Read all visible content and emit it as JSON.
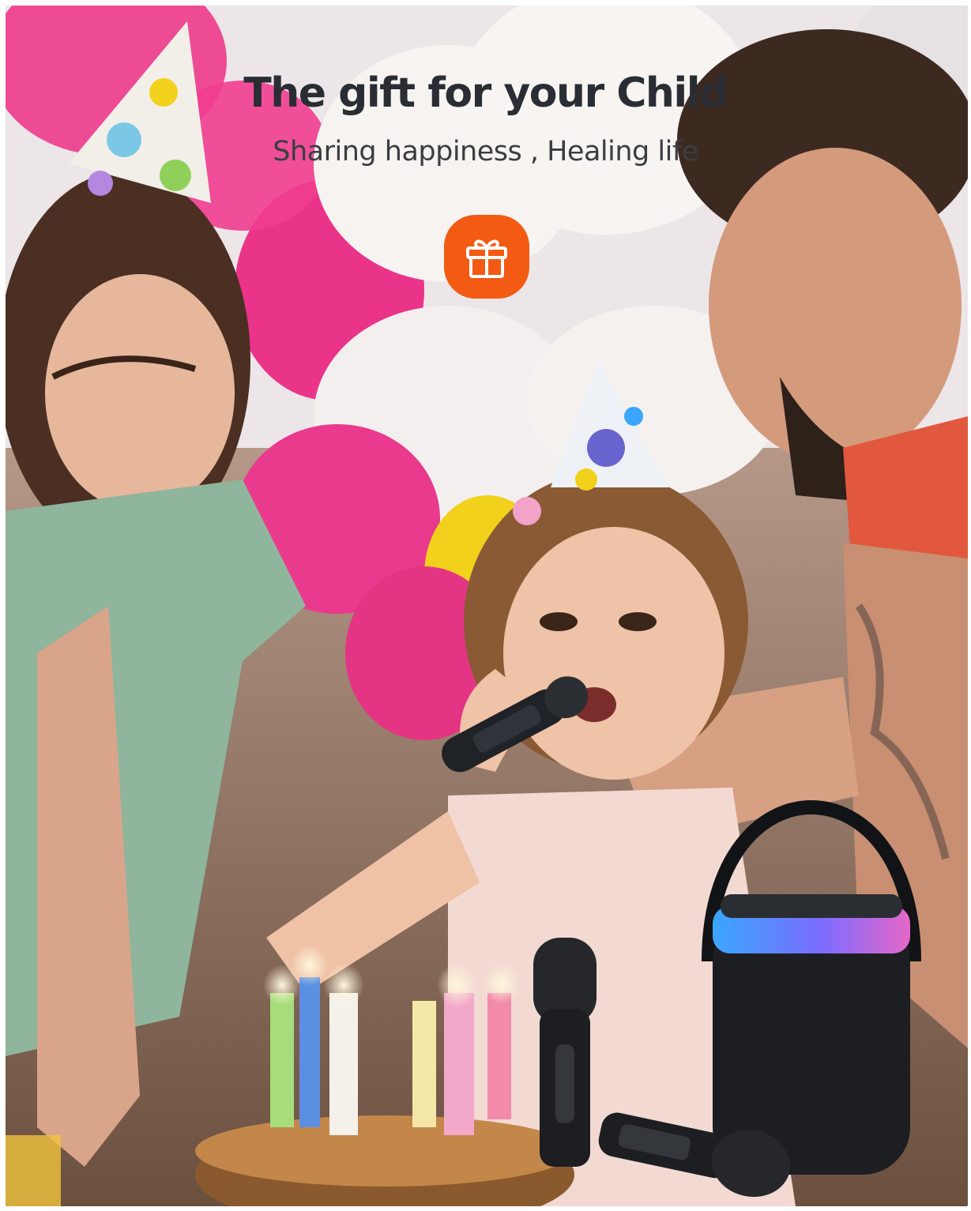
{
  "headline": "The gift for your Child",
  "subline": "Sharing happiness , Healing life",
  "gift_badge": {
    "icon": "gift-icon",
    "color": "#f35a14"
  },
  "photo": {
    "balloon_colors": [
      "#e5317f",
      "#f4f1ee",
      "#f2d11c"
    ],
    "light_ring_colors": [
      "#3aa6ff",
      "#7b6cff",
      "#e667c8"
    ]
  }
}
